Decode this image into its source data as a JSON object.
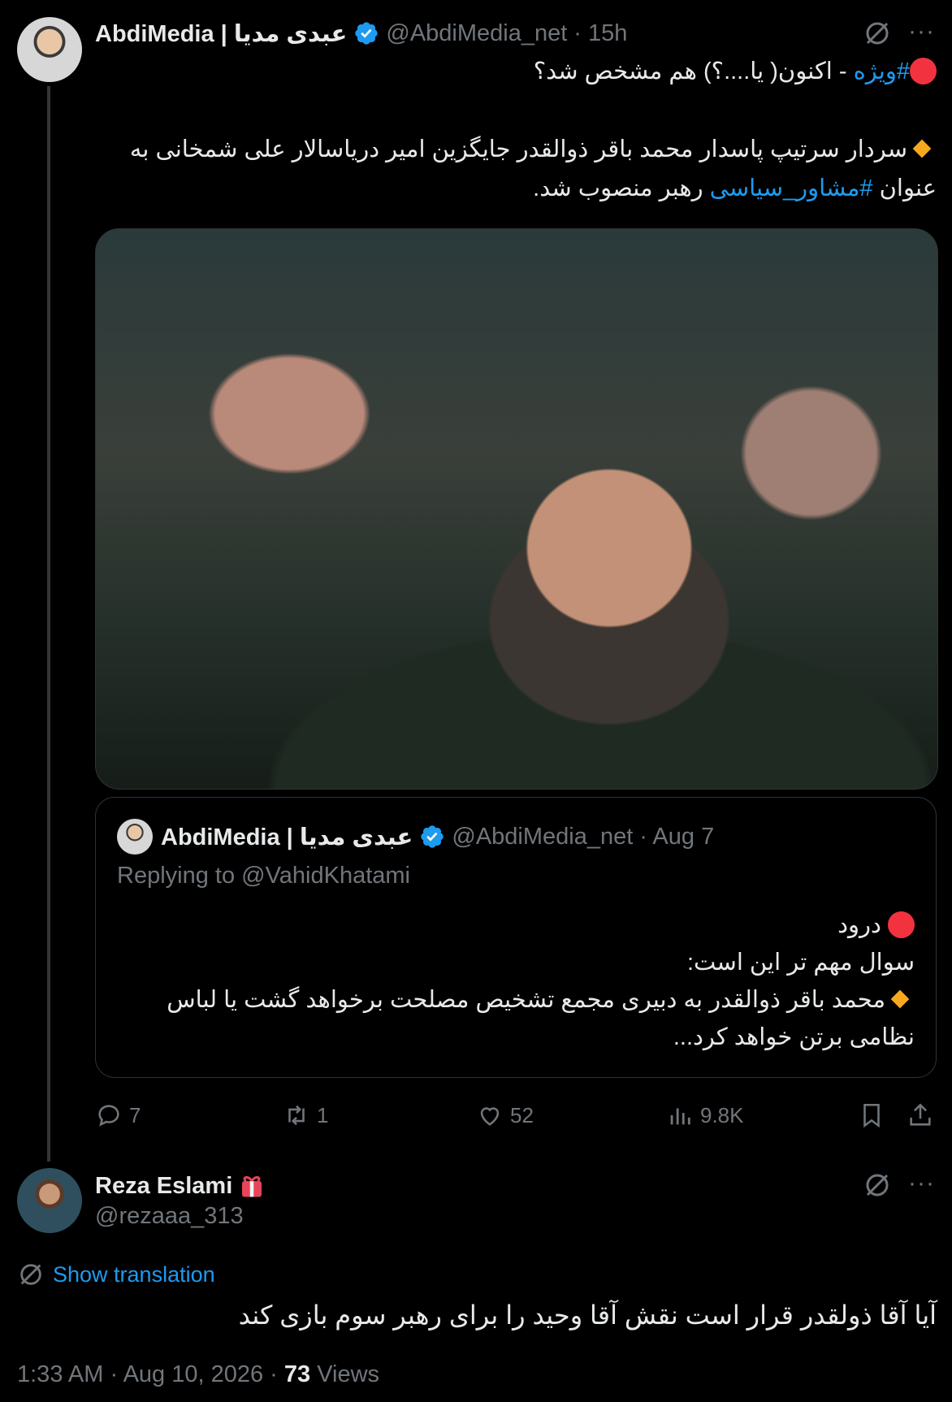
{
  "tweet": {
    "author_name": "AbdiMedia | عبدی مدیا",
    "author_handle": "@AbdiMedia_net",
    "time_ago": "· 15h",
    "line1_hashtag": "#ویژه",
    "line1_rest": " - اکنون( یا....؟) هم مشخص شد؟",
    "line2": "سردار سرتیپ پاسدار محمد باقر ذوالقدر جایگزین امیر دریاسالار علی شمخانی به",
    "line3_prefix": "عنوان ",
    "line3_hashtag": "#مشاور_سیاسی",
    "line3_rest": " رهبر منصوب شد.",
    "quote": {
      "author_name": "AbdiMedia | عبدی مدیا",
      "author_handle": "@AbdiMedia_net",
      "date": "· Aug 7",
      "replying": "Replying to @VahidKhatami",
      "line1": "درود",
      "line2": "سوال مهم تر این است:",
      "line3": "محمد باقر ذوالقدر به دبیری مجمع تشخیص مصلحت برخواهد گشت یا لباس",
      "line4": "نظامی برتن خواهد کرد..."
    },
    "actions": {
      "replies": "7",
      "retweets": "1",
      "likes": "52",
      "views": "9.8K"
    }
  },
  "reply": {
    "author_name": "Reza Eslami",
    "author_handle": "@rezaaa_313",
    "translate_label": "Show translation",
    "text": "آیا آقا ذولقدر قرار است نقش آقا وحید را برای رهبر سوم بازی کند",
    "timestamp": "1:33 AM · Aug 10, 2026 · ",
    "views_count": "73",
    "views_label": " Views"
  },
  "colors": {
    "accent": "#1d9bf0",
    "muted": "#71767b",
    "background": "#000000",
    "text": "#e7e9ea"
  }
}
